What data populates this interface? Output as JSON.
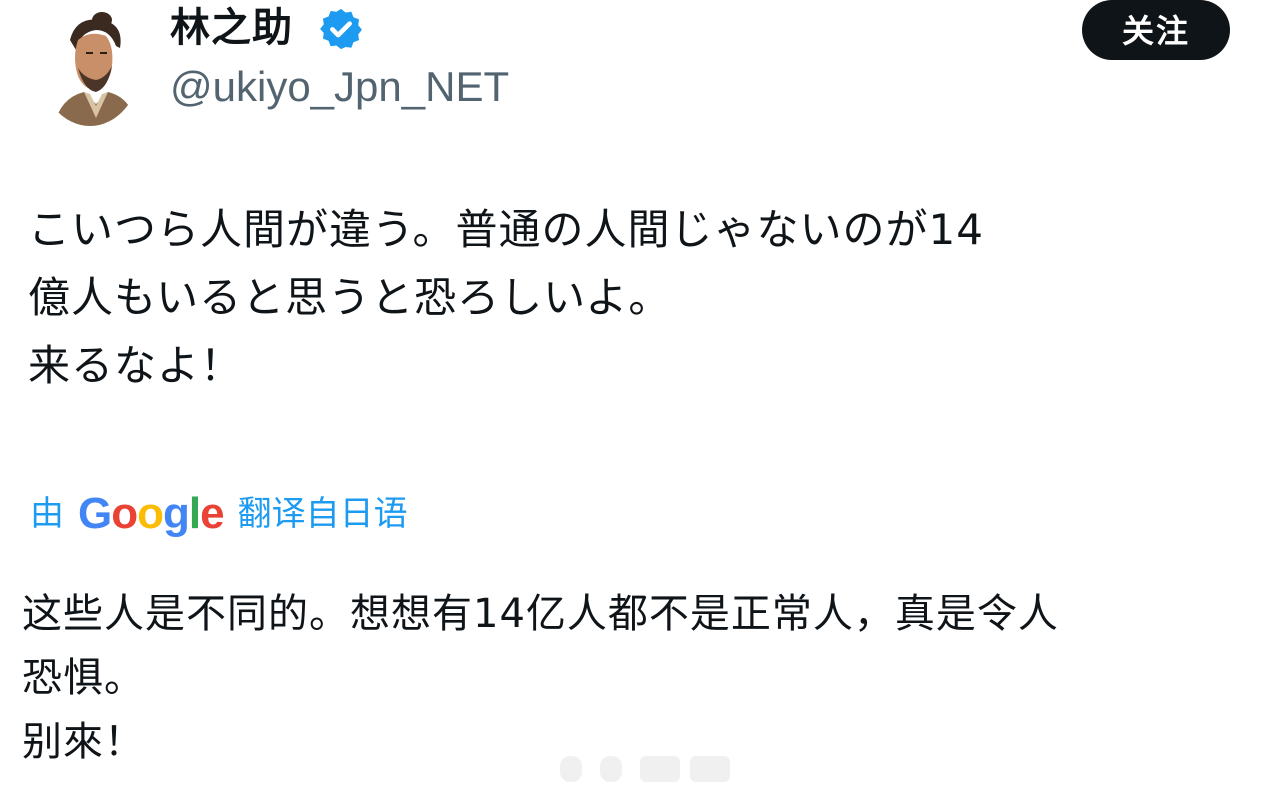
{
  "post": {
    "author": {
      "display_name": "林之助",
      "handle": "@ukiyo_Jpn_NET",
      "verified": true
    },
    "follow_button_label": "关注",
    "original_text_lines": [
      "こいつら人間が違う。普通の人間じゃないのが14",
      "億人もいると思うと恐ろしいよ。",
      "来るなよ！"
    ],
    "translation": {
      "prefix": "由",
      "provider_logo_text": "Google",
      "suffix": "翻译自日语"
    },
    "translated_text_lines": [
      "这些人是不同的。想想有14亿人都不是正常人，真是令人",
      "恐惧。",
      "别來！"
    ]
  },
  "icons": {
    "verified": "verified-badge-icon",
    "avatar": "avatar-portrait"
  },
  "colors": {
    "follow_button_bg": "#0f1419",
    "verified_blue": "#1d9bf0",
    "translate_link": "#1d9bf0",
    "google_blue": "#4285f4",
    "google_red": "#ea4335",
    "google_yellow": "#fbbc05",
    "google_green": "#34a853",
    "handle_gray": "#536471"
  }
}
